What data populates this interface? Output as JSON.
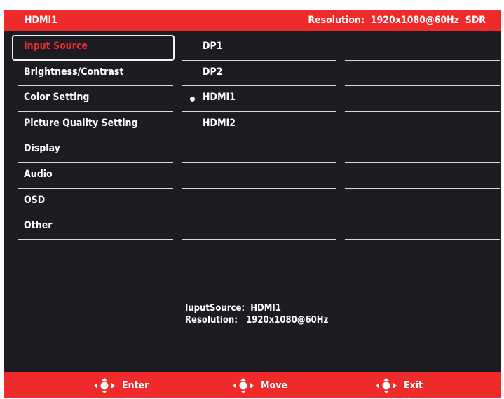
{
  "header": {
    "source": "HDMI1",
    "resolution_label": "Resolution:  1920x1080@60Hz",
    "mode": "SDR"
  },
  "menu": [
    {
      "label": "Input Source",
      "selected": true
    },
    {
      "label": "Brightness/Contrast"
    },
    {
      "label": "Color Setting"
    },
    {
      "label": "Picture Quality Setting"
    },
    {
      "label": "Display"
    },
    {
      "label": "Audio"
    },
    {
      "label": "OSD"
    },
    {
      "label": "Other"
    }
  ],
  "submenu": [
    {
      "label": "DP1"
    },
    {
      "label": "DP2"
    },
    {
      "label": "HDMI1",
      "active": true
    },
    {
      "label": "HDMI2"
    },
    {
      "label": ""
    },
    {
      "label": ""
    },
    {
      "label": ""
    },
    {
      "label": ""
    }
  ],
  "info": {
    "input_line": "IuputSource:  HDMI1",
    "resolution_line": "Resolution:   1920x1080@60Hz"
  },
  "footer": {
    "enter": "Enter",
    "move": "Move",
    "exit": "Exit"
  },
  "colors": {
    "accent": "#ee2b2a",
    "background": "#1c1c22",
    "text": "#ffffff"
  }
}
